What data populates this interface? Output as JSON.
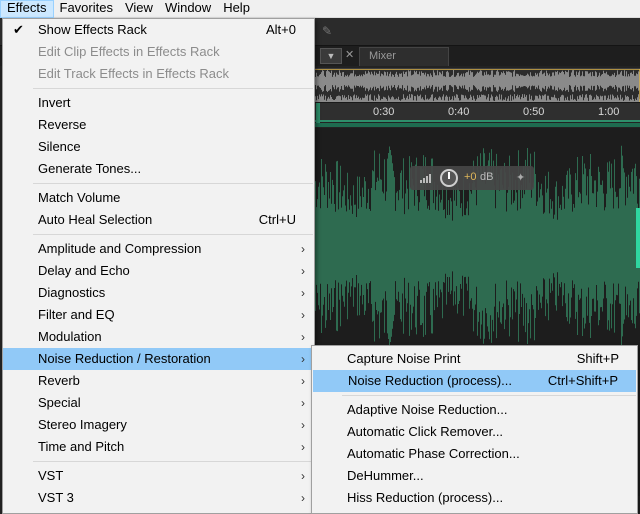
{
  "menubar": {
    "items": [
      "Effects",
      "Favorites",
      "View",
      "Window",
      "Help"
    ]
  },
  "background": {
    "mixer_tab": "Mixer",
    "ruler_ticks": [
      "0:30",
      "0:40",
      "0:50",
      "1:00"
    ],
    "hud_db_value": "+0",
    "hud_db_unit": "dB"
  },
  "effects_menu": {
    "items": [
      {
        "label": "Show Effects Rack",
        "shortcut": "Alt+0",
        "checked": true
      },
      {
        "label": "Edit Clip Effects in Effects Rack",
        "disabled": true
      },
      {
        "label": "Edit Track Effects in Effects Rack",
        "disabled": true
      },
      {
        "label": "Invert"
      },
      {
        "label": "Reverse"
      },
      {
        "label": "Silence"
      },
      {
        "label": "Generate Tones..."
      },
      {
        "label": "Match Volume"
      },
      {
        "label": "Auto Heal Selection",
        "shortcut": "Ctrl+U"
      },
      {
        "label": "Amplitude and Compression"
      },
      {
        "label": "Delay and Echo"
      },
      {
        "label": "Diagnostics"
      },
      {
        "label": "Filter and EQ"
      },
      {
        "label": "Modulation"
      },
      {
        "label": "Noise Reduction / Restoration"
      },
      {
        "label": "Reverb"
      },
      {
        "label": "Special"
      },
      {
        "label": "Stereo Imagery"
      },
      {
        "label": "Time and Pitch"
      },
      {
        "label": "VST"
      },
      {
        "label": "VST 3"
      }
    ]
  },
  "noise_submenu": {
    "items": [
      {
        "label": "Capture Noise Print",
        "shortcut": "Shift+P"
      },
      {
        "label": "Noise Reduction (process)...",
        "shortcut": "Ctrl+Shift+P"
      },
      {
        "label": "Adaptive Noise Reduction..."
      },
      {
        "label": "Automatic Click Remover..."
      },
      {
        "label": "Automatic Phase Correction..."
      },
      {
        "label": "DeHummer..."
      },
      {
        "label": "Hiss Reduction (process)..."
      }
    ]
  },
  "colors": {
    "highlight": "#91c9f7",
    "menubar_active": "#cce8ff",
    "waveform": "#2e6b50",
    "timeline_accent": "#2e8f6b"
  },
  "icons": {
    "check": "checkmark-icon",
    "submenu_arrow": "chevron-right-icon"
  }
}
